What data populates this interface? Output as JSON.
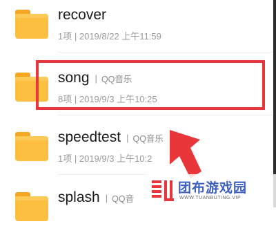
{
  "files": [
    {
      "name": "recover",
      "source": "",
      "count": "1项",
      "date": "2019/8/22 上午11:59",
      "icon": "folder-icon"
    },
    {
      "name": "song",
      "source": "QQ音乐",
      "count": "8项",
      "date": "2019/9/3 上午10:25",
      "icon": "folder-icon"
    },
    {
      "name": "speedtest",
      "source": "QQ音乐",
      "count": "1项",
      "date": "2019/9/3 上午10:2",
      "icon": "folder-icon"
    },
    {
      "name": "splash",
      "source": "QQ音",
      "count": "",
      "date": "",
      "icon": "folder-icon"
    }
  ],
  "separator": "|",
  "watermark": {
    "name": "团布游戏园",
    "url": "WWW.TUANBUTING.VIP"
  },
  "colors": {
    "highlight": "#e8363a",
    "folder": "#fcbf3f",
    "watermark": "#3d5fc2"
  }
}
